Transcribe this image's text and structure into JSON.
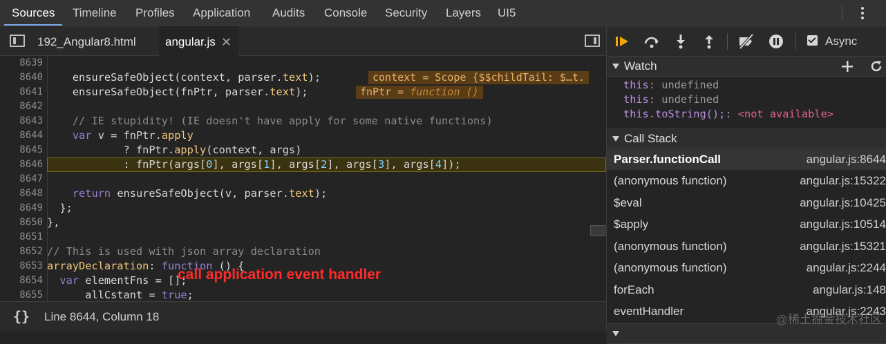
{
  "panel_tabs": [
    "Sources",
    "Timeline",
    "Profiles",
    "Application",
    "Audits",
    "Console",
    "Security",
    "Layers",
    "UI5"
  ],
  "file_tabs": [
    "192_Angular8.html",
    "angular.js"
  ],
  "code": {
    "line_numbers": [
      "8639",
      "8640",
      "8641",
      "8642",
      "8643",
      "8644",
      "8645",
      "8646",
      "8647",
      "8648",
      "8649",
      "8650",
      "8651",
      "8652",
      "8653",
      "8654",
      "8655"
    ],
    "l8640_a": "    ensureSafeObject(context, parser.",
    "l8640_b": "text",
    "l8640_c": ");",
    "l8641_a": "    ensureSafeObject(fnPtr, parser.",
    "l8641_b": "text",
    "l8641_c": ");",
    "l8643": "    // IE stupidity! (IE doesn't have apply for some native functions)",
    "l8644_a": "    ",
    "l8644_kw": "var",
    "l8644_b": " v = fnPtr.",
    "l8644_c": "apply",
    "l8645_a": "            ? fnPtr.",
    "l8645_b": "apply",
    "l8645_c": "(context, args)",
    "l8646_a": "            : fnPtr(args[",
    "l8646_n0": "0",
    "l8646_b": "], args[",
    "l8646_n1": "1",
    "l8646_c": "], args[",
    "l8646_n2": "2",
    "l8646_d": "], args[",
    "l8646_n3": "3",
    "l8646_e": "], args[",
    "l8646_n4": "4",
    "l8646_f": "]);",
    "l8648_a": "    ",
    "l8648_kw": "return",
    "l8648_b": " ensureSafeObject(v, parser.",
    "l8648_c": "text",
    "l8648_d": ");",
    "l8649": "  };",
    "l8650": "},",
    "l8652": "// This is used with json array declaration",
    "l8653_a": "arrayDeclaration",
    "l8653_b": ": ",
    "l8653_kw": "function",
    "l8653_c": " () {",
    "l8654_a": "  ",
    "l8654_kw": "var",
    "l8654_b": " elementFns = [];",
    "l8655_a": "      allC",
    "l8655_b": "stant = ",
    "l8655_kw": "true",
    "l8655_c": ";",
    "inline_8640": "context = Scope {$$childTail: $…t.",
    "inline_8641_a": "fnPtr = ",
    "inline_8641_b": "function ()"
  },
  "annotation": "call application event handler",
  "status": {
    "braces": "{}",
    "position": "Line 8644, Column 18"
  },
  "debugger": {
    "async_label": "Async",
    "watch_title": "Watch",
    "watch": [
      {
        "key": "this",
        "sep": ": ",
        "value": "undefined"
      },
      {
        "key": "this",
        "sep": ": ",
        "value": "undefined"
      },
      {
        "key": "this.toString();",
        "sep": ": ",
        "value": "<not available>"
      }
    ],
    "callstack_title": "Call Stack",
    "frames": [
      {
        "fn": "Parser.functionCall",
        "loc": "angular.js:8644"
      },
      {
        "fn": "(anonymous function)",
        "loc": "angular.js:15322"
      },
      {
        "fn": "$eval",
        "loc": "angular.js:10425"
      },
      {
        "fn": "$apply",
        "loc": "angular.js:10514"
      },
      {
        "fn": "(anonymous function)",
        "loc": "angular.js:15321"
      },
      {
        "fn": "(anonymous function)",
        "loc": "angular.js:2244"
      },
      {
        "fn": "forEach",
        "loc": "angular.js:148"
      },
      {
        "fn": "eventHandler",
        "loc": "angular.js:2243"
      }
    ]
  },
  "watermark": "@稀土掘金技术社区",
  "colors": {
    "accent": "#7ea8e6",
    "pause_orange": "#f3a50c",
    "annotation_red": "#ff2b2b"
  }
}
